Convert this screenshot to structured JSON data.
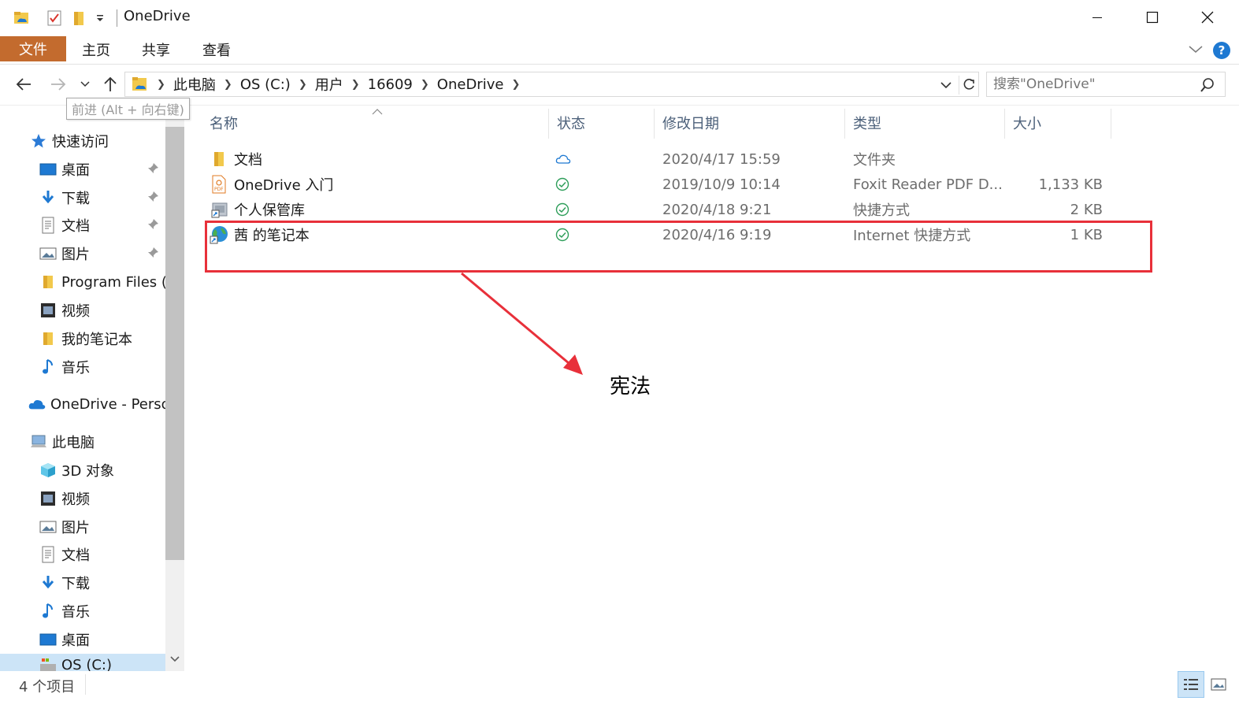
{
  "window": {
    "title": "OneDrive",
    "minimize_label": "─",
    "maximize_label": "☐",
    "close_label": "✕"
  },
  "ribbon": {
    "tabs": [
      "文件",
      "主页",
      "共享",
      "查看"
    ]
  },
  "address": {
    "crumbs": [
      "此电脑",
      "OS (C:)",
      "用户",
      "16609",
      "OneDrive"
    ],
    "search_placeholder": "搜索\"OneDrive\""
  },
  "tooltip": "前进 (Alt + 向右键)",
  "navpane": {
    "quick_access": "快速访问",
    "items": [
      {
        "label": "桌面",
        "icon": "desktop-icon"
      },
      {
        "label": "下载",
        "icon": "download-icon"
      },
      {
        "label": "文档",
        "icon": "document-icon"
      },
      {
        "label": "图片",
        "icon": "picture-icon"
      },
      {
        "label": "Program Files (x",
        "icon": "folder-icon"
      },
      {
        "label": "视频",
        "icon": "video-icon"
      },
      {
        "label": "我的笔记本",
        "icon": "folder-icon"
      },
      {
        "label": "音乐",
        "icon": "music-icon"
      }
    ],
    "onedrive": "OneDrive - Personal",
    "this_pc": "此电脑",
    "pc_items": [
      {
        "label": "3D 对象",
        "icon": "cube-icon"
      },
      {
        "label": "视频",
        "icon": "video-icon"
      },
      {
        "label": "图片",
        "icon": "picture-icon"
      },
      {
        "label": "文档",
        "icon": "document-icon"
      },
      {
        "label": "下载",
        "icon": "download-icon"
      },
      {
        "label": "音乐",
        "icon": "music-icon"
      },
      {
        "label": "桌面",
        "icon": "desktop-icon"
      }
    ],
    "drive": "OS (C:)"
  },
  "columns": {
    "name": "名称",
    "status": "状态",
    "date": "修改日期",
    "type": "类型",
    "size": "大小"
  },
  "files": [
    {
      "name": "文档",
      "status": "cloud",
      "date": "2020/4/17 15:59",
      "type": "文件夹",
      "size": "",
      "icon": "folder-icon"
    },
    {
      "name": "OneDrive 入门",
      "status": "synced",
      "date": "2019/10/9 10:14",
      "type": "Foxit Reader PDF D...",
      "size": "1,133 KB",
      "icon": "pdf-icon"
    },
    {
      "name": "个人保管库",
      "status": "synced",
      "date": "2020/4/18 9:21",
      "type": "快捷方式",
      "size": "2 KB",
      "icon": "shortcut-icon"
    },
    {
      "name": "茜 的笔记本",
      "status": "synced",
      "date": "2020/4/16 9:19",
      "type": "Internet 快捷方式",
      "size": "1 KB",
      "icon": "globe-icon"
    }
  ],
  "annotation": "宪法",
  "status_bar": "4 个项目",
  "colors": {
    "file_tab": "#c36b2e",
    "highlight": "#e8303a",
    "sync_green": "#2e9e5a",
    "cloud_blue": "#1e79d2"
  }
}
